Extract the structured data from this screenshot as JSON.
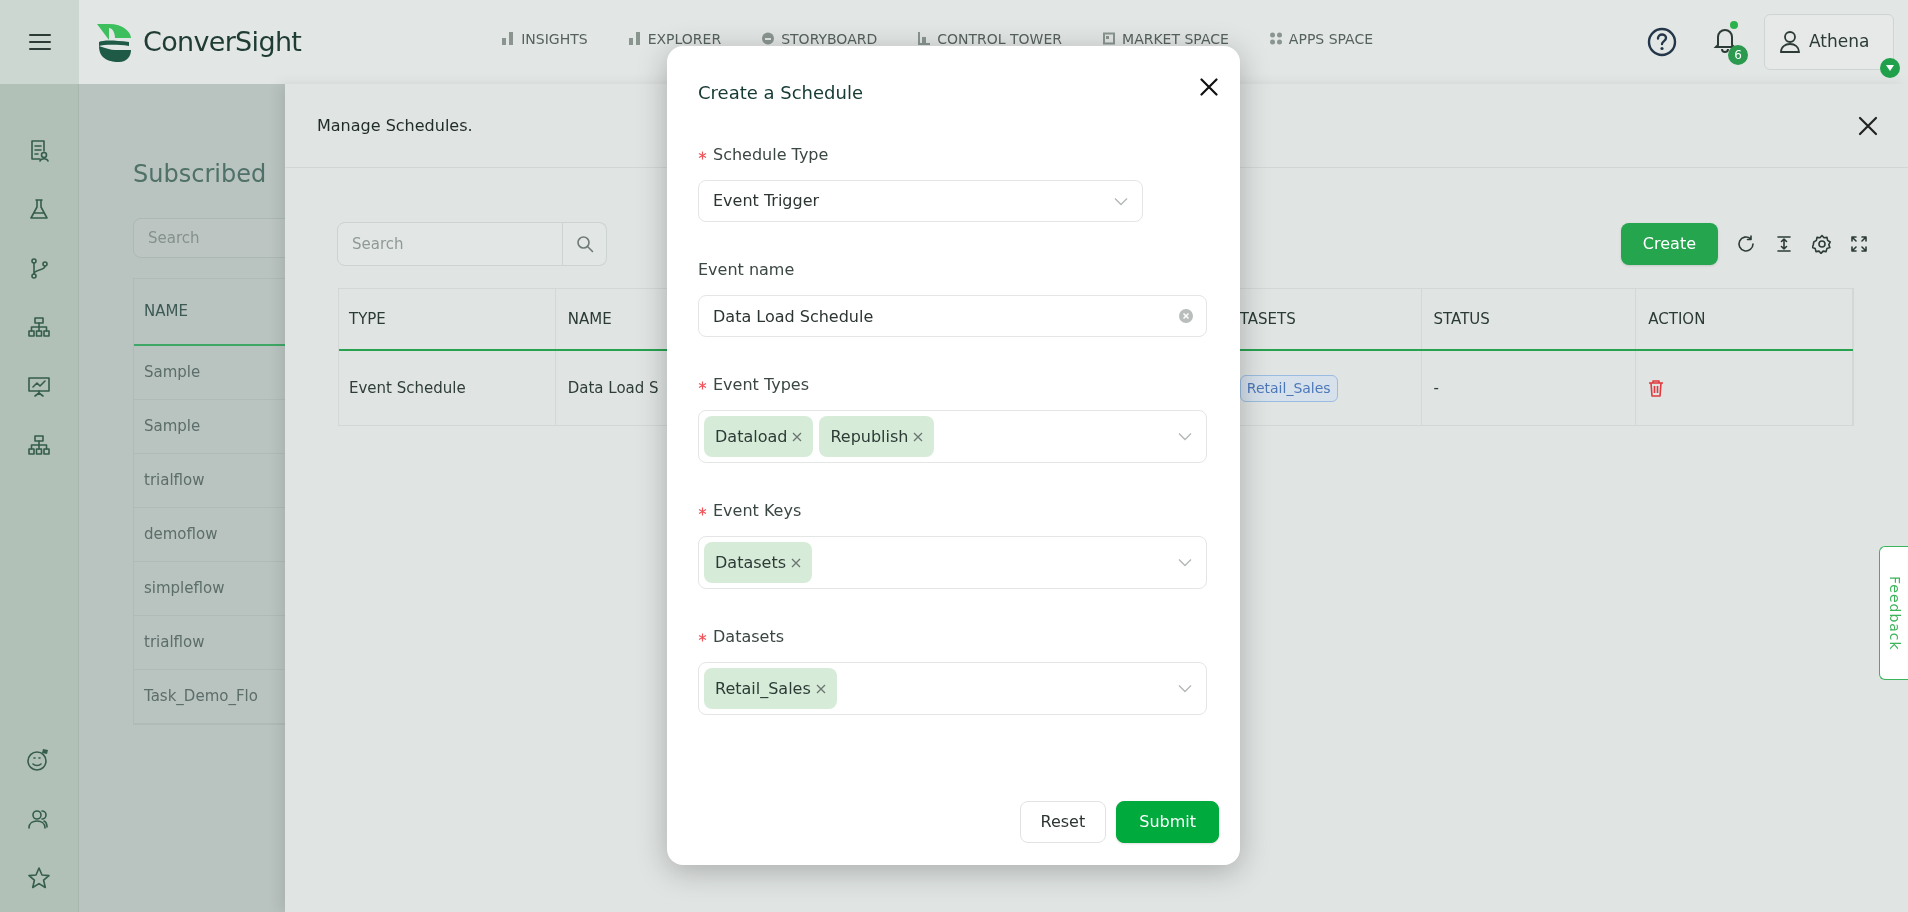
{
  "top_bar": {
    "logo_text": "ConverSight",
    "nav": [
      {
        "label": "INSIGHTS",
        "selected": false
      },
      {
        "label": "EXPLORER",
        "selected": false
      },
      {
        "label": "STORYBOARD",
        "selected": false
      },
      {
        "label": "CONTROL TOWER",
        "selected": false
      },
      {
        "label": "MARKET SPACE",
        "selected": false
      },
      {
        "label": "APPS SPACE",
        "selected": false
      }
    ],
    "notification_count": "6",
    "user": "Athena"
  },
  "background_page": {
    "title": "Subscribed",
    "search": {
      "placeholder": "Search"
    },
    "table": {
      "columns": [
        "NAME"
      ],
      "rows": [
        "Sample",
        "Sample",
        "trialflow",
        "demoflow",
        "simpleflow",
        "trialflow",
        "Task_Demo_Flo"
      ]
    }
  },
  "drawer": {
    "title": "Manage Schedules.",
    "search": {
      "placeholder": "Search"
    },
    "create_button": "Create",
    "table": {
      "columns": [
        "TYPE",
        "NAME",
        "",
        "TASETS",
        "STATUS",
        "ACTION"
      ],
      "rows": [
        {
          "type": "Event Schedule",
          "name": "Data Load S",
          "datasets": [
            "Retail_Sales"
          ],
          "status": "-"
        }
      ]
    }
  },
  "modal": {
    "title": "Create a Schedule",
    "fields": [
      {
        "kind": "select",
        "label": "Schedule Type",
        "required": true,
        "value": "Event Trigger"
      },
      {
        "kind": "text",
        "label": "Event name",
        "required": false,
        "value": "Data Load Schedule"
      },
      {
        "kind": "tags",
        "label": "Event Types",
        "required": true,
        "tags": [
          "Dataload",
          "Republish"
        ]
      },
      {
        "kind": "tags",
        "label": "Event Keys",
        "required": true,
        "tags": [
          "Datasets"
        ]
      },
      {
        "kind": "tags",
        "label": "Datasets",
        "required": true,
        "tags": [
          "Retail_Sales"
        ]
      }
    ],
    "buttons": [
      {
        "label": "Reset",
        "primary": false
      },
      {
        "label": "Submit",
        "primary": true
      }
    ]
  },
  "feedback_tab": "Feedback"
}
